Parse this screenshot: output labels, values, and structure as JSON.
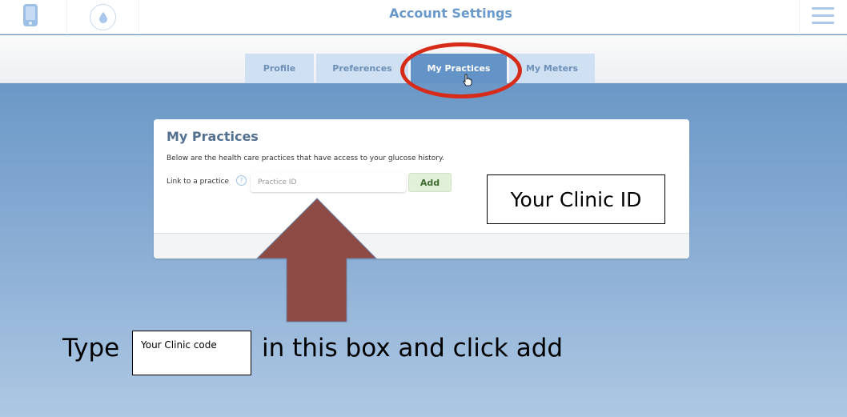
{
  "header": {
    "title": "Account Settings",
    "icons": [
      "phone-icon",
      "drop-icon",
      "menu-icon"
    ]
  },
  "tabs": [
    {
      "label": "Profile",
      "active": false
    },
    {
      "label": "Preferences",
      "active": false
    },
    {
      "label": "My Practices",
      "active": true
    },
    {
      "label": "My Meters",
      "active": false
    }
  ],
  "card": {
    "title": "My Practices",
    "description": "Below are the health care practices that have access to your glucose history.",
    "link_label": "Link to a practice",
    "help_glyph": "?",
    "input_placeholder": "Practice ID",
    "input_value": "",
    "add_label": "Add"
  },
  "annotations": {
    "callout_id": "Your Clinic ID",
    "instruction_prefix": "Type",
    "instruction_box": "Your Clinic code",
    "instruction_suffix": "in this box and click add",
    "highlight_color": "#d72b1a",
    "arrow_color": "#8e4a44"
  },
  "colors": {
    "accent": "#6a99cc",
    "active_tab": "#6493c8",
    "inactive_tab": "#cfe0f3",
    "add_button": "#e0f0d9"
  }
}
